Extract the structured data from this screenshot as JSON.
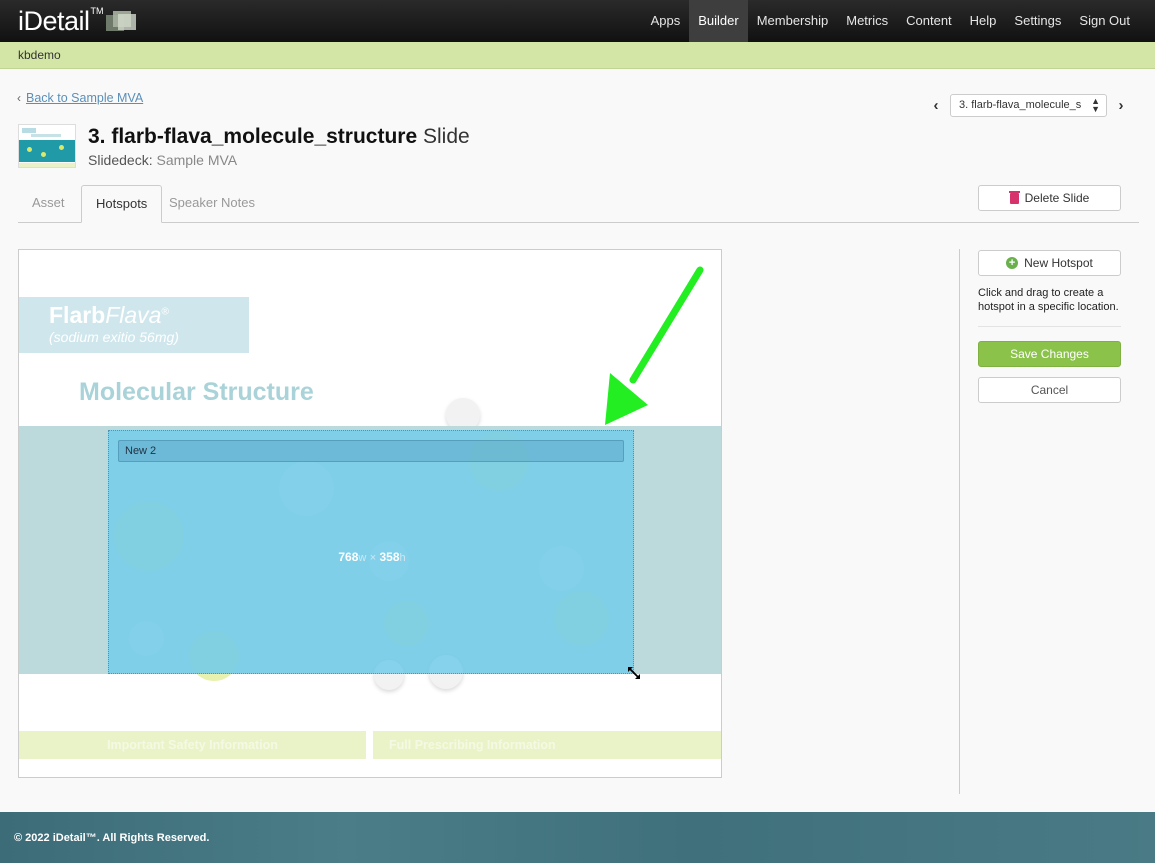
{
  "app": {
    "logo_text": "iDetail",
    "logo_tm": "TM"
  },
  "nav": [
    {
      "label": "Apps"
    },
    {
      "label": "Builder",
      "active": true
    },
    {
      "label": "Membership"
    },
    {
      "label": "Metrics"
    },
    {
      "label": "Content"
    },
    {
      "label": "Help"
    },
    {
      "label": "Settings"
    },
    {
      "label": "Sign Out"
    }
  ],
  "org": "kbdemo",
  "back_link": "Back to Sample MVA",
  "slide_select": {
    "value": "3. flarb-flava_molecule_s"
  },
  "header": {
    "number": "3.",
    "name": "flarb-flava_molecule_structure",
    "suffix": "Slide",
    "deck_label": "Slidedeck:",
    "deck_name": "Sample MVA"
  },
  "tabs": [
    {
      "label": "Asset"
    },
    {
      "label": "Hotspots",
      "active": true
    },
    {
      "label": "Speaker Notes"
    }
  ],
  "delete_button": "Delete Slide",
  "slide": {
    "brand_bold": "Flarb",
    "brand_italic": "Flava",
    "brand_reg": "®",
    "brand_sub": "(sodium exitio 56mg)",
    "heading": "Molecular Structure",
    "footer_left": "Important Safety Information",
    "footer_right": "Full Prescribing Information"
  },
  "hotspot": {
    "name": "New 2",
    "width": "768",
    "width_unit": "w",
    "times": "×",
    "height": "358",
    "height_unit": "h"
  },
  "panel": {
    "new_hotspot": "New Hotspot",
    "help": "Click and drag to create a hotspot in a specific location.",
    "save": "Save Changes",
    "cancel": "Cancel"
  },
  "footer": {
    "copyright": "© 2022 iDetail™.  All Rights Reserved."
  },
  "colors": {
    "accent_green": "#8bc34a",
    "subbar": "#d4e6a6",
    "hotspot_fill": "#76cdeb",
    "arrow": "#22ee22"
  }
}
